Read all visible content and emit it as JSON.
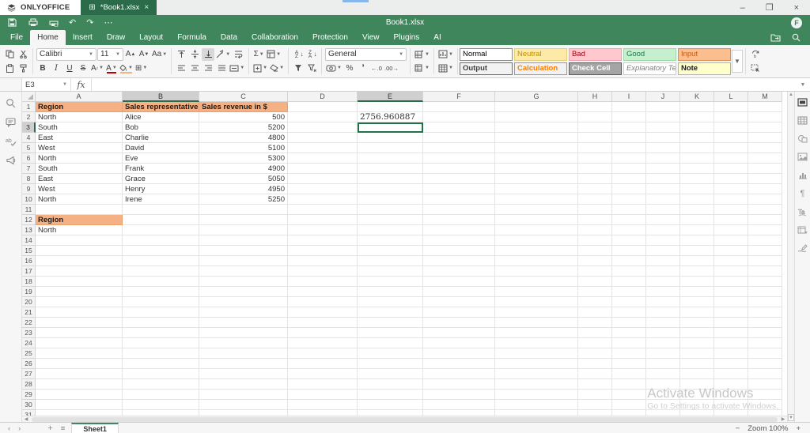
{
  "window": {
    "brand": "ONLYOFFICE",
    "doc_tab": "*Book1.xlsx",
    "tab_close": "×",
    "minimize": "–",
    "restore": "❐",
    "close": "×"
  },
  "titlebar": {
    "title": "Book1.xlsx",
    "more": "⋯",
    "avatar_initial": "F"
  },
  "menu": {
    "active": "Home",
    "items": [
      "File",
      "Home",
      "Insert",
      "Draw",
      "Layout",
      "Formula",
      "Data",
      "Collaboration",
      "Protection",
      "View",
      "Plugins",
      "AI"
    ]
  },
  "toolbar": {
    "font_name": "Calibri",
    "font_size": "11",
    "number_format": "General",
    "styles": [
      {
        "name": "Normal",
        "bg": "#ffffff",
        "color": "#000000",
        "bold": false,
        "italic": false,
        "border": "#8a8a8a"
      },
      {
        "name": "Neutral",
        "bg": "#fdeaa8",
        "color": "#bf8f00",
        "bold": false,
        "italic": false,
        "border": "#e6cf7a"
      },
      {
        "name": "Bad",
        "bg": "#ffc7ce",
        "color": "#9c0006",
        "bold": false,
        "italic": false,
        "border": "#f0a5ad"
      },
      {
        "name": "Good",
        "bg": "#c6efce",
        "color": "#217346",
        "bold": false,
        "italic": false,
        "border": "#9fd6aa"
      },
      {
        "name": "Input",
        "bg": "#fbbe8f",
        "color": "#c55a11",
        "bold": false,
        "italic": false,
        "border": "#d99056"
      },
      {
        "name": "Output",
        "bg": "#f2f2f2",
        "color": "#3f3f3f",
        "bold": true,
        "italic": false,
        "border": "#6e6e6e"
      },
      {
        "name": "Calculation",
        "bg": "#f2f2f2",
        "color": "#fa7d00",
        "bold": true,
        "italic": false,
        "border": "#9a9a9a"
      },
      {
        "name": "Check Cell",
        "bg": "#a5a5a5",
        "color": "#ffffff",
        "bold": true,
        "italic": false,
        "border": "#5f5f5f"
      },
      {
        "name": "Explanatory Text",
        "bg": "#ffffff",
        "color": "#7f7f7f",
        "bold": false,
        "italic": true,
        "border": "#cdcdcd"
      },
      {
        "name": "Note",
        "bg": "#ffffcc",
        "color": "#1a1a1a",
        "bold": true,
        "italic": false,
        "border": "#b2b2b2"
      }
    ]
  },
  "formula_bar": {
    "cell_ref": "E3",
    "fx": "fx",
    "value": ""
  },
  "sheet": {
    "columns": [
      "A",
      "B",
      "C",
      "D",
      "E",
      "F",
      "G",
      "H",
      "I",
      "J",
      "K",
      "L",
      "M"
    ],
    "rows_visible": 31,
    "selected_columns": [
      "B",
      "E"
    ],
    "selected_row": 3,
    "active_cell": "E3",
    "cells": {
      "A1": {
        "v": "Region",
        "cls": "c-hdr"
      },
      "B1": {
        "v": "Sales representative",
        "cls": "c-hdr"
      },
      "C1": {
        "v": "Sales revenue in $",
        "cls": "c-hdr"
      },
      "A2": {
        "v": "North"
      },
      "B2": {
        "v": "Alice"
      },
      "C2": {
        "v": "500",
        "cls": "c-num"
      },
      "A3": {
        "v": "South"
      },
      "B3": {
        "v": "Bob"
      },
      "C3": {
        "v": "5200",
        "cls": "c-num"
      },
      "A4": {
        "v": "East"
      },
      "B4": {
        "v": "Charlie"
      },
      "C4": {
        "v": "4800",
        "cls": "c-num"
      },
      "A5": {
        "v": "West"
      },
      "B5": {
        "v": "David"
      },
      "C5": {
        "v": "5100",
        "cls": "c-num"
      },
      "A6": {
        "v": "North"
      },
      "B6": {
        "v": "Eve"
      },
      "C6": {
        "v": "5300",
        "cls": "c-num"
      },
      "A7": {
        "v": "South"
      },
      "B7": {
        "v": "Frank"
      },
      "C7": {
        "v": "4900",
        "cls": "c-num"
      },
      "A8": {
        "v": "East"
      },
      "B8": {
        "v": "Grace"
      },
      "C8": {
        "v": "5050",
        "cls": "c-num"
      },
      "A9": {
        "v": "West"
      },
      "B9": {
        "v": "Henry"
      },
      "C9": {
        "v": "4950",
        "cls": "c-num"
      },
      "A10": {
        "v": "North"
      },
      "B10": {
        "v": "Irene"
      },
      "C10": {
        "v": "5250",
        "cls": "c-num"
      },
      "E2": {
        "v": "2756.960887",
        "cls": "c-serif"
      },
      "A12": {
        "v": "Region",
        "cls": "c-hdr"
      },
      "A13": {
        "v": "North"
      }
    }
  },
  "statusbar": {
    "sheet_tab": "Sheet1",
    "zoom": "Zoom 100%"
  },
  "watermark": {
    "line1": "Activate Windows",
    "line2": "Go to Settings to activate Windows."
  }
}
